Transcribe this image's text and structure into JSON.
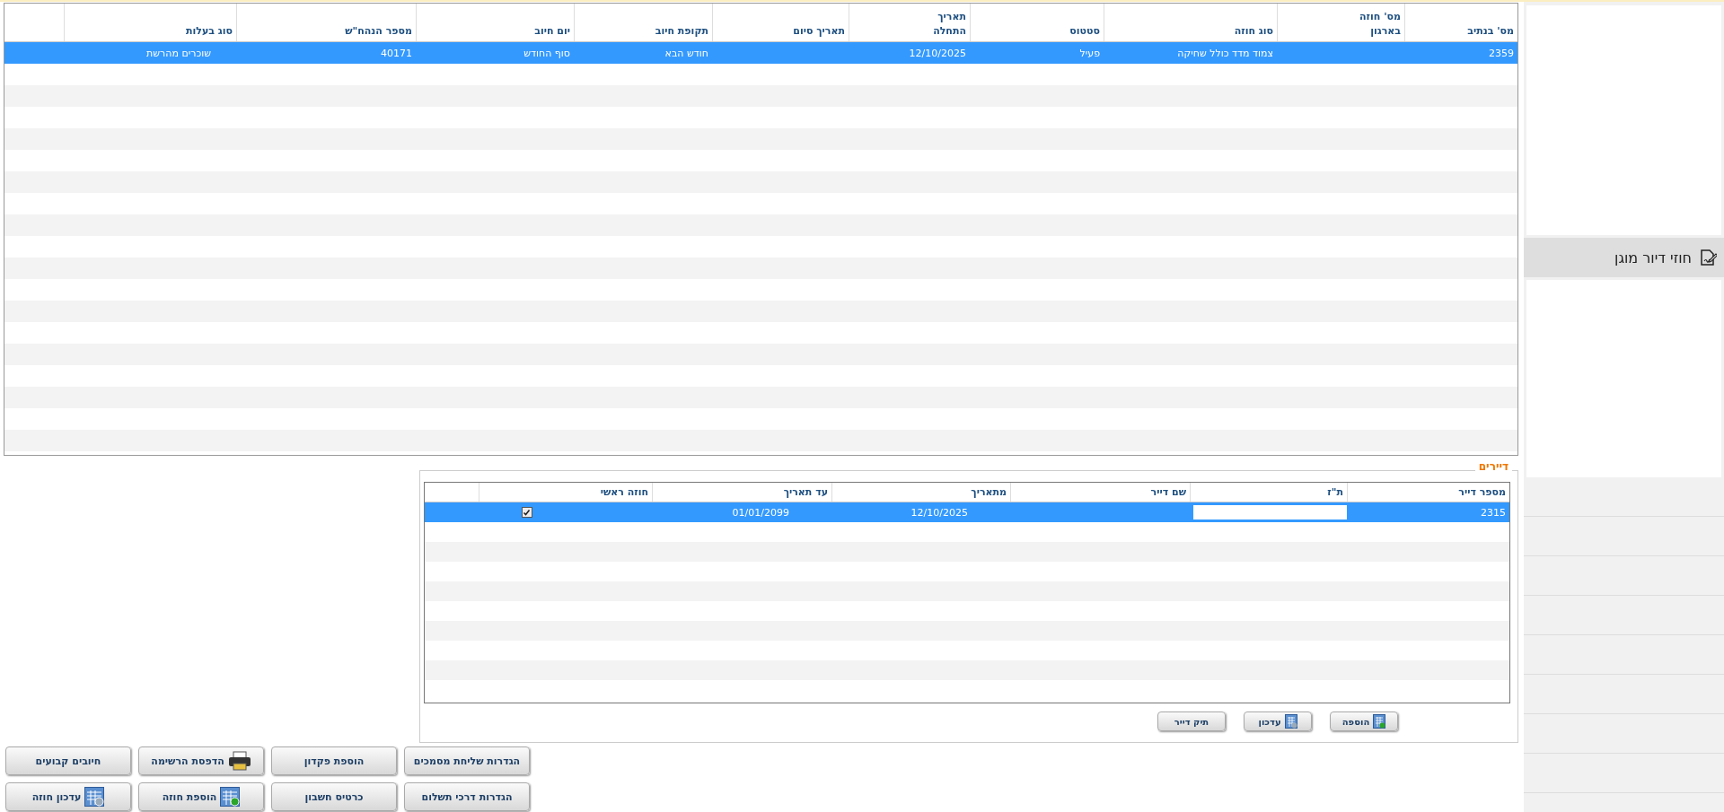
{
  "contracts_table": {
    "columns": [
      "מס' בנתיב",
      "מס' חוזה בארגון",
      "סוג חוזה",
      "סטטוס",
      "תאריך התחלה",
      "תאריך סיום",
      "תקופת חיוב",
      "יום חיוב",
      "מספר הנהח\"ש",
      "סוג בעלות"
    ],
    "rows": [
      {
        "selected": true,
        "cells": [
          "2359",
          null,
          "צמוד מדד כולל שחיקה",
          "פעיל",
          "12/10/2025",
          null,
          "חודש הבא",
          "סוף החודש",
          "40171",
          "שוכרים מהרשת"
        ]
      }
    ]
  },
  "tenants": {
    "title": "דיירים",
    "columns": [
      "מספר דייר",
      "ת\"ז",
      "שם דייר",
      "מתאריך",
      "עד תאריך",
      "חוזה ראשי"
    ],
    "rows": [
      {
        "selected": true,
        "main_contract": true,
        "cells": [
          "2315",
          null,
          null,
          "12/10/2025",
          "01/01/2099"
        ]
      }
    ],
    "buttons": [
      {
        "label": "הוספה",
        "kind": "add"
      },
      {
        "label": "עדכון",
        "kind": "edit"
      },
      {
        "label": "תיק דייר",
        "kind": "plain"
      }
    ]
  },
  "action_buttons": [
    {
      "label": "הגדרות שליחת מסמכים",
      "kind": "plain"
    },
    {
      "label": "הוספת פקדון",
      "kind": "plain"
    },
    {
      "label": "הדפסת הרשימה",
      "kind": "print"
    },
    {
      "label": "חיובים קבועים",
      "kind": "plain"
    },
    {
      "label": "הגדרות דרכי תשלום",
      "kind": "plain"
    },
    {
      "label": "כרטיס חשבון",
      "kind": "plain"
    },
    {
      "label": "הוספת חוזה",
      "kind": "add"
    },
    {
      "label": "עדכון חוזה",
      "kind": "edit"
    }
  ],
  "sidebar": {
    "items": [
      {
        "label": "חוזי דיור מוגן",
        "selected": true
      }
    ]
  }
}
